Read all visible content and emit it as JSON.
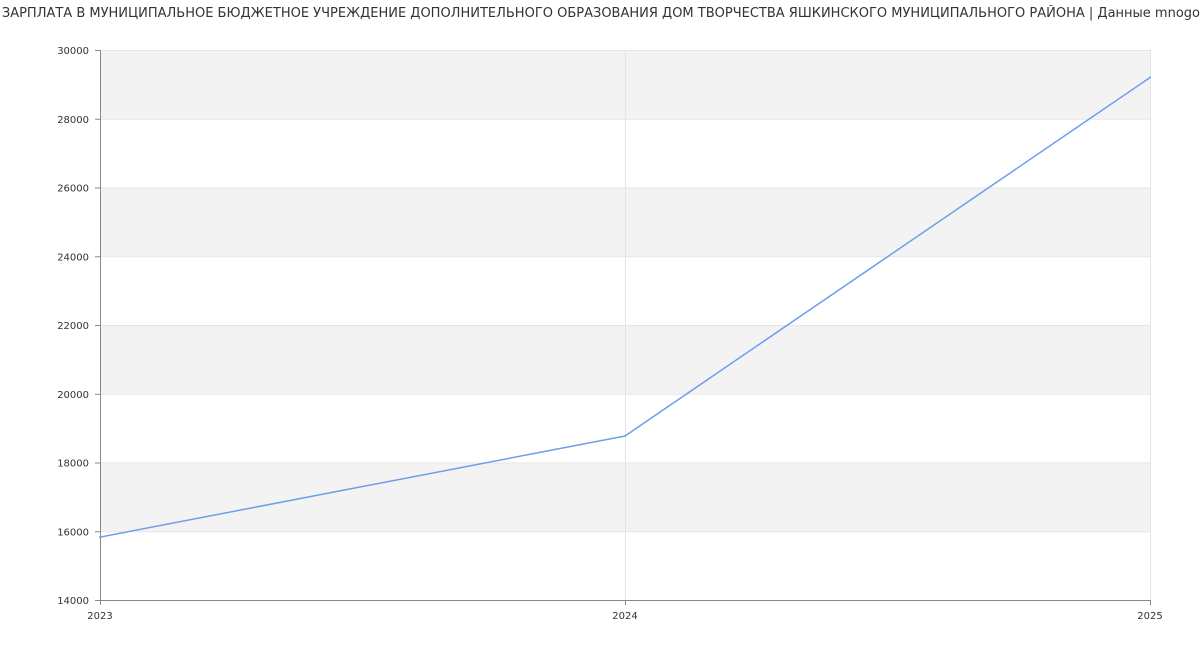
{
  "chart_data": {
    "type": "line",
    "title": "ЗАРПЛАТА В МУНИЦИПАЛЬНОЕ БЮДЖЕТНОЕ УЧРЕЖДЕНИЕ ДОПОЛНИТЕЛЬНОГО ОБРАЗОВАНИЯ ДОМ  ТВОРЧЕСТВА ЯШКИНСКОГО МУНИЦИПАЛЬНОГО РАЙОНА | Данные mnogo",
    "x": [
      "2023",
      "2024",
      "2025"
    ],
    "series": [
      {
        "values": [
          15830,
          18770,
          29200
        ],
        "color": "#6d9eeb"
      }
    ],
    "xlabel": "",
    "ylabel": "",
    "ylim": [
      14000,
      30000
    ],
    "yticks": [
      14000,
      16000,
      18000,
      20000,
      22000,
      24000,
      26000,
      28000,
      30000
    ],
    "grid": true,
    "band_color": "#f3f3f3",
    "grid_color": "#e5e5e5",
    "axis_color": "#888888"
  }
}
